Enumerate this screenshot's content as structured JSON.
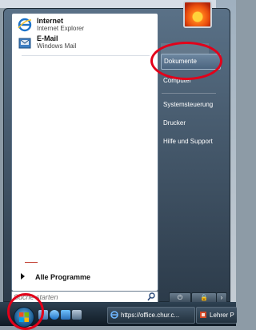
{
  "start_menu": {
    "pinned": [
      {
        "title": "Internet",
        "subtitle": "Internet Explorer",
        "icon": "internet-explorer-icon"
      },
      {
        "title": "E-Mail",
        "subtitle": "Windows Mail",
        "icon": "windows-mail-icon"
      }
    ],
    "all_programs_label": "Alle Programme",
    "search_placeholder": "Suche starten",
    "right_items": [
      {
        "label": "Dokumente",
        "highlighted": true
      },
      {
        "label": "Computer"
      },
      {
        "label": "Systemsteuerung"
      },
      {
        "label": "Drucker"
      },
      {
        "label": "Hilfe und Support"
      }
    ]
  },
  "taskbar": {
    "buttons": [
      {
        "label": "https://office.chur.c...",
        "icon": "internet-explorer-icon"
      },
      {
        "label": "Lehrer P",
        "icon": "presentation-icon"
      }
    ]
  },
  "annotations": {
    "color": "#e2001a"
  }
}
